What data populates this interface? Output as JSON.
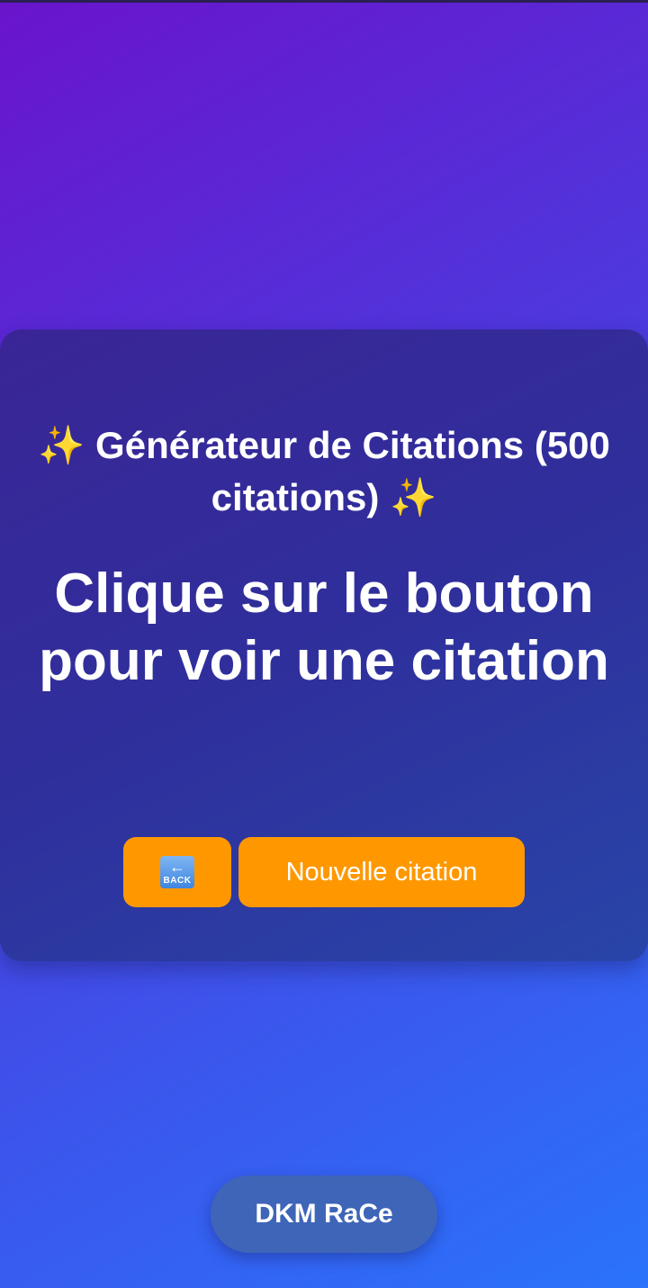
{
  "header": {
    "title": "✨ Générateur de Citations (500 citations) ✨"
  },
  "quote": {
    "text": "Clique sur le bouton pour voir une citation"
  },
  "actions": {
    "back_icon": "back-arrow-icon",
    "back_label": "BACK",
    "back_arrow": "←",
    "new_quote_label": "Nouvelle citation"
  },
  "footer": {
    "label": "DKM RaCe"
  },
  "colors": {
    "accent": "#ff9800",
    "card": "#30309c",
    "footer_pill": "#3f65b8"
  }
}
